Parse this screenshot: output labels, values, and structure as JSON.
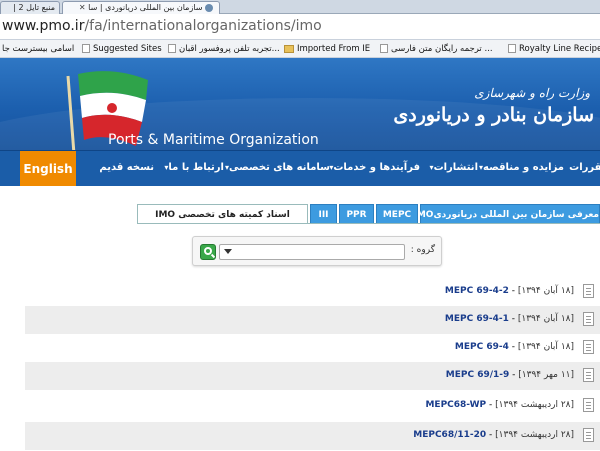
{
  "browser": {
    "tabs": [
      {
        "title": "سازمان بین المللی دریانوردی | سا",
        "active": true
      },
      {
        "title": "منبع تایل 2 |",
        "active": false
      }
    ],
    "url_host": "www.pmo.ir",
    "url_path": "/fa/internationalorganizations/imo",
    "bookmarks": [
      "Royalty Line Recipes...",
      "ترجمه رایگان متن فارسی ...",
      "Imported From IE",
      "تجربه تلفن پروفسور اقبان...",
      "Suggested Sites",
      "اسامی بیسترست جا"
    ]
  },
  "header": {
    "ministry": "وزارت راه و شهرسازی",
    "org_fa": "سازمان بنادر و دریانوردی",
    "org_en": "Ports & Maritime Organization"
  },
  "nav": {
    "english": "English",
    "items": [
      "مقررات",
      "مزایده و مناقصه",
      "انتشارات",
      "فرآیندها و خدمات",
      "سامانه های تخصصی",
      "ارتباط با ما",
      "نسخه قدیم"
    ]
  },
  "content": {
    "tabs": [
      "معرفی سازمان بین المللی دریانوردیIMO",
      "MEPC",
      "PPR",
      "III",
      "اسناد کمیته های تخصصی IMO"
    ],
    "filter_label": "گروه :",
    "filter_value": "",
    "documents": [
      {
        "code": "MEPC 69-4-2",
        "date": "[۱۸ آبان ۱۳۹۴]"
      },
      {
        "code": "MEPC 69-4-1",
        "date": "[۱۸ آبان ۱۳۹۴]"
      },
      {
        "code": "MEPC 69-4",
        "date": "[۱۸ آبان ۱۳۹۴]"
      },
      {
        "code": "MEPC 69/1-9",
        "date": "[۱۱ مهر ۱۳۹۴]"
      },
      {
        "code": "MEPC68-WP",
        "date": "[۲۸ اردیبهشت ۱۳۹۴]"
      },
      {
        "code": "MEPC68/11-20",
        "date": "[۲۸ اردیبهشت ۱۳۹۴]"
      }
    ]
  },
  "colors": {
    "header_blue": "#1c5fae",
    "nav_blue": "#1b5da8",
    "english_orange": "#f08a00",
    "tab_blue": "#3d9be0",
    "link_blue": "#1a3d8c"
  }
}
